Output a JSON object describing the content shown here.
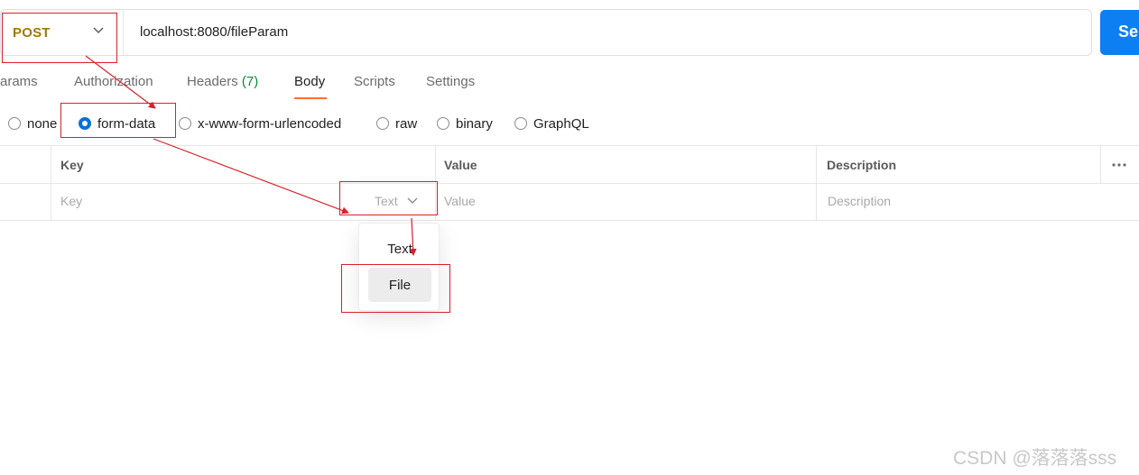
{
  "request": {
    "method": "POST",
    "url": "localhost:8080/fileParam",
    "send_label": "Se"
  },
  "tabs": [
    {
      "label": "Params",
      "visible_text": "Params"
    },
    {
      "label": "Authorization"
    },
    {
      "label": "Headers",
      "count": "(7)"
    },
    {
      "label": "Body",
      "active": true
    },
    {
      "label": "Scripts"
    },
    {
      "label": "Settings"
    }
  ],
  "body_types": [
    {
      "label": "none",
      "selected": false
    },
    {
      "label": "form-data",
      "selected": true
    },
    {
      "label": "x-www-form-urlencoded",
      "selected": false
    },
    {
      "label": "raw",
      "selected": false
    },
    {
      "label": "binary",
      "selected": false
    },
    {
      "label": "GraphQL",
      "selected": false
    }
  ],
  "table": {
    "headers": {
      "key": "Key",
      "value": "Value",
      "description": "Description"
    },
    "placeholders": {
      "key": "Key",
      "value": "Value",
      "description": "Description"
    },
    "type_select": "Text"
  },
  "type_dropdown": {
    "options": [
      "Text",
      "File"
    ],
    "highlighted": "File"
  },
  "colors": {
    "method": "#a17900",
    "send": "#0c7ff2",
    "active_tab_underline": "#ff6c37",
    "headers_count": "#0a8a3c",
    "radio_selected": "#0c6fd6",
    "annotation": "#d9202a"
  },
  "watermark": "CSDN @落落落sss"
}
